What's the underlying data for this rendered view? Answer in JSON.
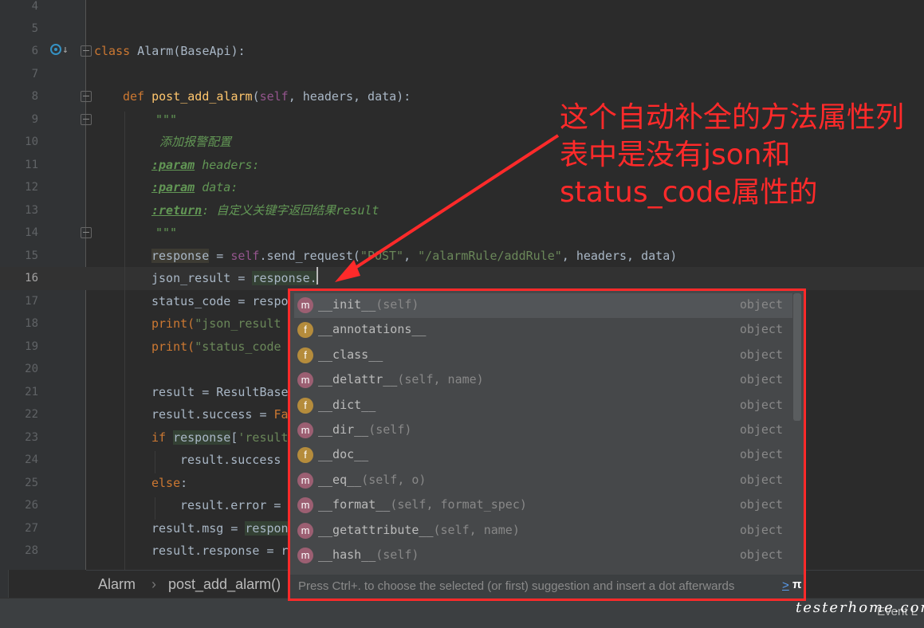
{
  "editor": {
    "line_numbers": [
      "4",
      "5",
      "6",
      "7",
      "8",
      "9",
      "10",
      "11",
      "12",
      "13",
      "14",
      "15",
      "16",
      "17",
      "18",
      "19",
      "20",
      "21",
      "22",
      "23",
      "24",
      "25",
      "26",
      "27",
      "28"
    ],
    "lines": {
      "l6": {
        "kw": "class",
        "rest": " Alarm(BaseApi):"
      },
      "l8": {
        "kw": "def",
        "fn": "post_add_alarm",
        "open": "(",
        "self": "self",
        "rest": ", headers, data):"
      },
      "l9": "\"\"\"",
      "l10": "添加报警配置",
      "l11": {
        "tag": ":param",
        "rest": " headers:"
      },
      "l12": {
        "tag": ":param",
        "rest": " data:"
      },
      "l13": {
        "tag": ":return",
        "rest": ": 自定义关键字返回结果result"
      },
      "l14": "\"\"\"",
      "l15": {
        "a": "response",
        "b": " = ",
        "self": "self",
        "c": ".send_request(",
        "s1": "\"POST\"",
        "d": ", ",
        "s2": "\"/alarmRule/addRule\"",
        "e": ", headers, data)"
      },
      "l16": {
        "a": "json_result = ",
        "b": "response."
      },
      "l17": "status_code = respo",
      "l18": {
        "a": "print(",
        "s": "\"json_result"
      },
      "l19": {
        "a": "print(",
        "s": "\"status_code"
      },
      "l21": "result = ResultBase",
      "l22": {
        "a": "result.success = ",
        "k": "Fa"
      },
      "l23": {
        "kw": "if",
        "a": " ",
        "b": "response",
        "c": "[",
        "s": "'result"
      },
      "l24": "result.success =",
      "l25": {
        "kw": "else",
        "a": ":"
      },
      "l26": "result.error = ",
      "l27": {
        "a": "result.msg = ",
        "b": "respon"
      },
      "l28": "result.response = re"
    }
  },
  "breadcrumb": {
    "class_name": "Alarm",
    "separator": "›",
    "method": "post_add_alarm()"
  },
  "completion": {
    "items": [
      {
        "kind": "m",
        "name": "__init__",
        "params": "(self)",
        "type": "object"
      },
      {
        "kind": "f",
        "name": "__annotations__",
        "params": "",
        "type": "object"
      },
      {
        "kind": "f",
        "name": "__class__",
        "params": "",
        "type": "object"
      },
      {
        "kind": "m",
        "name": "__delattr__",
        "params": "(self, name)",
        "type": "object"
      },
      {
        "kind": "f",
        "name": "__dict__",
        "params": "",
        "type": "object"
      },
      {
        "kind": "m",
        "name": "__dir__",
        "params": "(self)",
        "type": "object"
      },
      {
        "kind": "f",
        "name": "__doc__",
        "params": "",
        "type": "object"
      },
      {
        "kind": "m",
        "name": "__eq__",
        "params": "(self, o)",
        "type": "object"
      },
      {
        "kind": "m",
        "name": "__format__",
        "params": "(self, format_spec)",
        "type": "object"
      },
      {
        "kind": "m",
        "name": "__getattribute__",
        "params": "(self, name)",
        "type": "object"
      },
      {
        "kind": "m",
        "name": "__hash__",
        "params": "(self)",
        "type": "object"
      }
    ],
    "hint_text": "Press Ctrl+. to choose the selected (or first) suggestion and insert a dot afterwards",
    "hint_link": ">",
    "hint_pi": "π"
  },
  "annotation": {
    "text": "这个自动补全的方法属性列表中是没有json和status_code属性的",
    "line1": "这个自动补全的方法属性列",
    "line2": "表中是没有json和",
    "line3": "status_code属性的",
    "color": "#ff2a2a"
  },
  "status": {
    "event_log": "Event L"
  },
  "watermark": "testerhome.com"
}
